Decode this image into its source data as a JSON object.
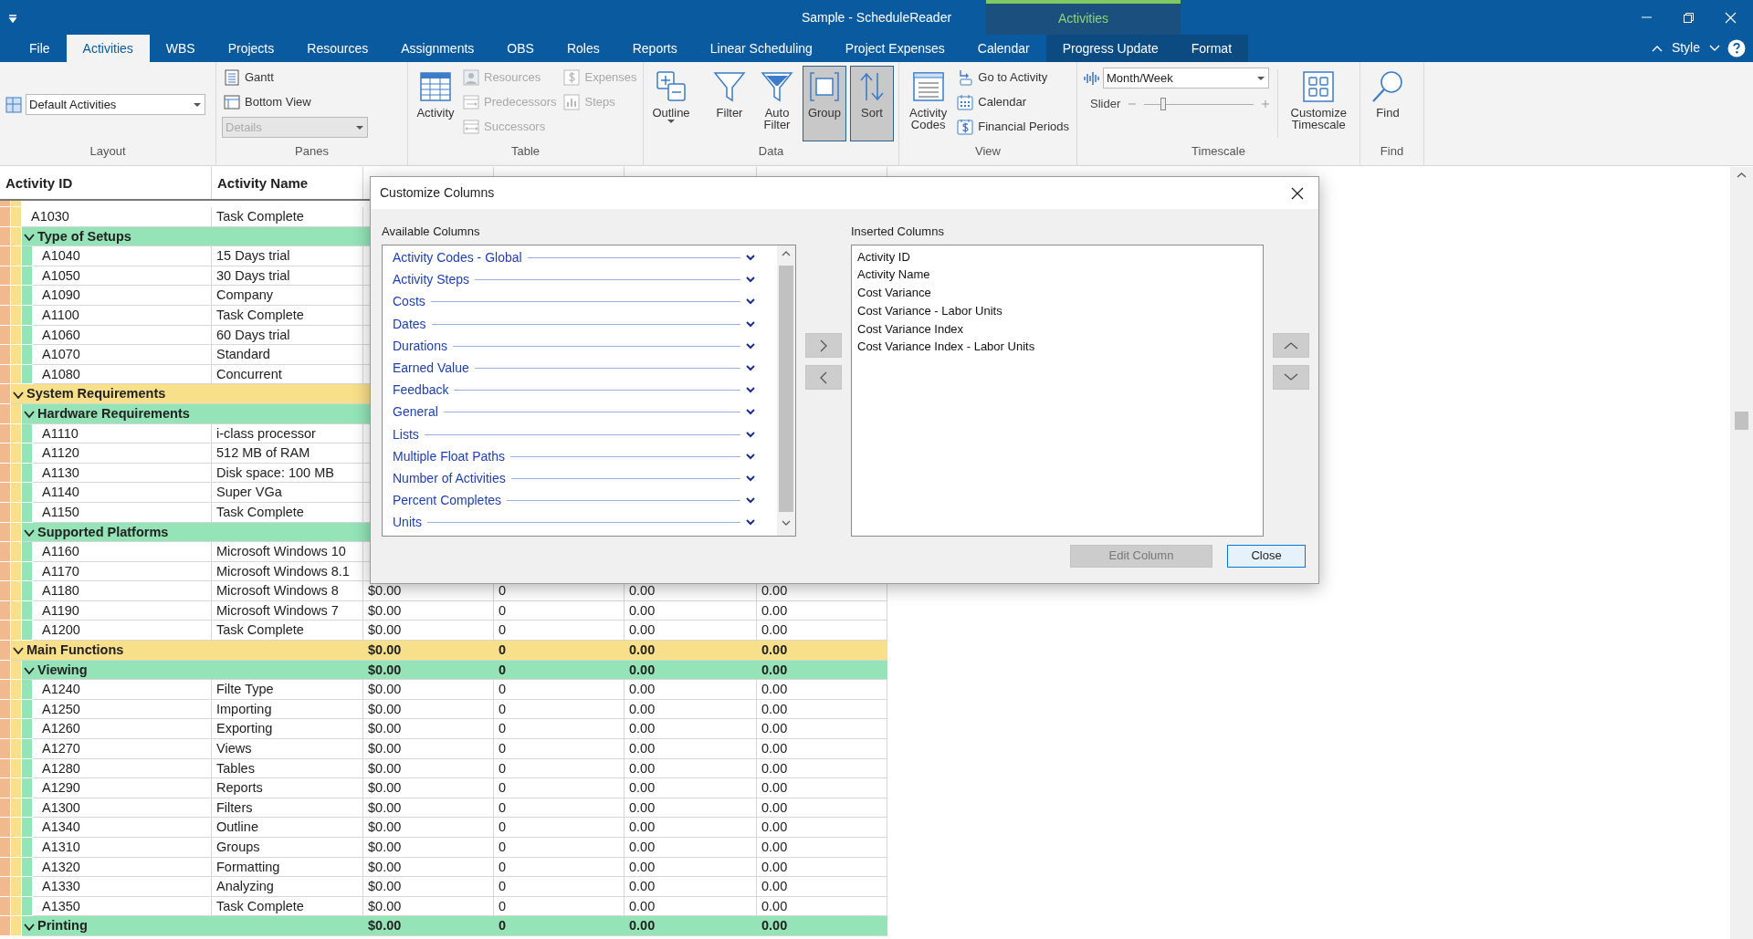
{
  "window": {
    "title": "Sample - ScheduleReader",
    "context_title": "Activities"
  },
  "tabs": [
    {
      "label": "File",
      "selected": false,
      "contextual": false
    },
    {
      "label": "Activities",
      "selected": true,
      "contextual": false
    },
    {
      "label": "WBS",
      "selected": false,
      "contextual": false
    },
    {
      "label": "Projects",
      "selected": false,
      "contextual": false
    },
    {
      "label": "Resources",
      "selected": false,
      "contextual": false
    },
    {
      "label": "Assignments",
      "selected": false,
      "contextual": false
    },
    {
      "label": "OBS",
      "selected": false,
      "contextual": false
    },
    {
      "label": "Roles",
      "selected": false,
      "contextual": false
    },
    {
      "label": "Reports",
      "selected": false,
      "contextual": false
    },
    {
      "label": "Linear Scheduling",
      "selected": false,
      "contextual": false
    },
    {
      "label": "Project Expenses",
      "selected": false,
      "contextual": false
    },
    {
      "label": "Calendar",
      "selected": false,
      "contextual": false
    },
    {
      "label": "Progress Update",
      "selected": false,
      "contextual": true
    },
    {
      "label": "Format",
      "selected": false,
      "contextual": true
    }
  ],
  "style_menu": "Style",
  "ribbon": [
    {
      "label": "Layout",
      "items": [
        {
          "kind": "combo",
          "value": "Default Activities",
          "disabled": false
        }
      ]
    },
    {
      "label": "Panes",
      "items": [
        {
          "kind": "small",
          "label": "Gantt",
          "disabled": false
        },
        {
          "kind": "small",
          "label": "Bottom View",
          "disabled": false
        },
        {
          "kind": "combo",
          "value": "Details",
          "disabled": true
        }
      ]
    },
    {
      "label": "Table",
      "items": [
        {
          "kind": "large",
          "label": "Activity",
          "pressed": false
        },
        {
          "kind": "small",
          "label": "Resources",
          "disabled": true
        },
        {
          "kind": "small",
          "label": "Predecessors",
          "disabled": true
        },
        {
          "kind": "small",
          "label": "Successors",
          "disabled": true
        },
        {
          "kind": "small",
          "label": "Expenses",
          "disabled": true
        },
        {
          "kind": "small",
          "label": "Steps",
          "disabled": true
        }
      ]
    },
    {
      "label": "Data",
      "items": [
        {
          "kind": "large",
          "label": "Outline",
          "pressed": false,
          "menu": true
        },
        {
          "kind": "separator"
        },
        {
          "kind": "large",
          "label": "Filter",
          "pressed": false
        },
        {
          "kind": "large",
          "label": "Auto Filter",
          "pressed": false
        },
        {
          "kind": "large",
          "label": "Group",
          "pressed": true
        },
        {
          "kind": "large",
          "label": "Sort",
          "pressed": true
        }
      ]
    },
    {
      "label": "View",
      "items": [
        {
          "kind": "large",
          "label": "Activity Codes",
          "pressed": false
        },
        {
          "kind": "small",
          "label": "Go to Activity",
          "disabled": false
        },
        {
          "kind": "small",
          "label": "Calendar",
          "disabled": false
        },
        {
          "kind": "small",
          "label": "Financial Periods",
          "disabled": false
        }
      ]
    },
    {
      "label": "Timescale",
      "items": [
        {
          "kind": "combo",
          "value": "Month/Week",
          "disabled": false
        },
        {
          "kind": "slider",
          "label": "Slider",
          "level": 0.17
        },
        {
          "kind": "separator"
        },
        {
          "kind": "large",
          "label": "Customize Timescale",
          "pressed": false
        }
      ]
    },
    {
      "label": "Find",
      "items": [
        {
          "kind": "large",
          "label": "Find",
          "pressed": false
        }
      ]
    }
  ],
  "table": {
    "columns": [
      "Activity ID",
      "Activity Name"
    ],
    "rows": [
      {
        "kind": "group",
        "children": [
          {
            "kind": "activity",
            "id": "A1030",
            "name": "Task Complete"
          },
          {
            "kind": "group",
            "name": "Type of Setups",
            "expanded": true,
            "children": [
              {
                "kind": "activity",
                "id": "A1040",
                "name": "15 Days trial"
              },
              {
                "kind": "activity",
                "id": "A1050",
                "name": "30 Days trial"
              },
              {
                "kind": "activity",
                "id": "A1090",
                "name": "Company"
              },
              {
                "kind": "activity",
                "id": "A1100",
                "name": "Task Complete"
              },
              {
                "kind": "activity",
                "id": "A1060",
                "name": "60 Days trial"
              },
              {
                "kind": "activity",
                "id": "A1070",
                "name": "Standard"
              },
              {
                "kind": "activity",
                "id": "A1080",
                "name": "Concurrent"
              }
            ]
          }
        ]
      },
      {
        "kind": "group",
        "name": "System Requirements",
        "expanded": true,
        "children": [
          {
            "kind": "group",
            "name": "Hardware Requirements",
            "expanded": true,
            "children": [
              {
                "kind": "activity",
                "id": "A1110",
                "name": "i-class processor"
              },
              {
                "kind": "activity",
                "id": "A1120",
                "name": "512 MB of RAM"
              },
              {
                "kind": "activity",
                "id": "A1130",
                "name": "Disk space: 100 MB"
              },
              {
                "kind": "activity",
                "id": "A1140",
                "name": "Super VGa"
              },
              {
                "kind": "activity",
                "id": "A1150",
                "name": "Task Complete"
              }
            ]
          },
          {
            "kind": "group",
            "name": "Supported Platforms",
            "expanded": true,
            "children": [
              {
                "kind": "activity",
                "id": "A1160",
                "name": "Microsoft Windows 10"
              },
              {
                "kind": "activity",
                "id": "A1170",
                "name": "Microsoft Windows 8.1"
              },
              {
                "kind": "activity",
                "id": "A1180",
                "name": "Microsoft Windows 8",
                "values": [
                  "$0.00",
                  "0",
                  "0.00",
                  "0.00"
                ]
              },
              {
                "kind": "activity",
                "id": "A1190",
                "name": "Microsoft Windows 7",
                "values": [
                  "$0.00",
                  "0",
                  "0.00",
                  "0.00"
                ]
              },
              {
                "kind": "activity",
                "id": "A1200",
                "name": "Task Complete",
                "values": [
                  "$0.00",
                  "0",
                  "0.00",
                  "0.00"
                ]
              }
            ]
          }
        ]
      },
      {
        "kind": "group",
        "name": "Main Functions",
        "expanded": true,
        "values": [
          "$0.00",
          "0",
          "0.00",
          "0.00"
        ],
        "children": [
          {
            "kind": "group",
            "name": "Viewing",
            "expanded": true,
            "values": [
              "$0.00",
              "0",
              "0.00",
              "0.00"
            ],
            "children": [
              {
                "kind": "activity",
                "id": "A1240",
                "name": "Filte Type",
                "values": [
                  "$0.00",
                  "0",
                  "0.00",
                  "0.00"
                ]
              },
              {
                "kind": "activity",
                "id": "A1250",
                "name": "Importing",
                "values": [
                  "$0.00",
                  "0",
                  "0.00",
                  "0.00"
                ]
              },
              {
                "kind": "activity",
                "id": "A1260",
                "name": "Exporting",
                "values": [
                  "$0.00",
                  "0",
                  "0.00",
                  "0.00"
                ]
              },
              {
                "kind": "activity",
                "id": "A1270",
                "name": "Views",
                "values": [
                  "$0.00",
                  "0",
                  "0.00",
                  "0.00"
                ]
              },
              {
                "kind": "activity",
                "id": "A1280",
                "name": "Tables",
                "values": [
                  "$0.00",
                  "0",
                  "0.00",
                  "0.00"
                ]
              },
              {
                "kind": "activity",
                "id": "A1290",
                "name": "Reports",
                "values": [
                  "$0.00",
                  "0",
                  "0.00",
                  "0.00"
                ]
              },
              {
                "kind": "activity",
                "id": "A1300",
                "name": "Filters",
                "values": [
                  "$0.00",
                  "0",
                  "0.00",
                  "0.00"
                ]
              },
              {
                "kind": "activity",
                "id": "A1340",
                "name": "Outline",
                "values": [
                  "$0.00",
                  "0",
                  "0.00",
                  "0.00"
                ]
              },
              {
                "kind": "activity",
                "id": "A1310",
                "name": "Groups",
                "values": [
                  "$0.00",
                  "0",
                  "0.00",
                  "0.00"
                ]
              },
              {
                "kind": "activity",
                "id": "A1320",
                "name": "Formatting",
                "values": [
                  "$0.00",
                  "0",
                  "0.00",
                  "0.00"
                ]
              },
              {
                "kind": "activity",
                "id": "A1330",
                "name": "Analyzing",
                "values": [
                  "$0.00",
                  "0",
                  "0.00",
                  "0.00"
                ]
              },
              {
                "kind": "activity",
                "id": "A1350",
                "name": "Task Complete",
                "values": [
                  "$0.00",
                  "0",
                  "0.00",
                  "0.00"
                ]
              }
            ]
          },
          {
            "kind": "group",
            "name": "Printing",
            "expanded": true,
            "values": [
              "$0.00",
              "0",
              "0.00",
              "0.00"
            ]
          }
        ]
      }
    ]
  },
  "dialog": {
    "title": "Customize Columns",
    "available_label": "Available Columns",
    "available": [
      {
        "label": "Activity Codes - Global",
        "expanded": false
      },
      {
        "label": "Activity Steps",
        "expanded": false
      },
      {
        "label": "Costs",
        "expanded": false
      },
      {
        "label": "Dates",
        "expanded": false
      },
      {
        "label": "Durations",
        "expanded": false
      },
      {
        "label": "Earned Value",
        "expanded": false
      },
      {
        "label": "Feedback",
        "expanded": false
      },
      {
        "label": "General",
        "expanded": false
      },
      {
        "label": "Lists",
        "expanded": false
      },
      {
        "label": "Multiple Float Paths",
        "expanded": false
      },
      {
        "label": "Number of Activities",
        "expanded": false
      },
      {
        "label": "Percent Completes",
        "expanded": false
      },
      {
        "label": "Units",
        "expanded": false
      }
    ],
    "inserted_label": "Inserted Columns",
    "inserted": [
      "Activity ID",
      "Activity Name",
      "Cost Variance",
      "Cost Variance - Labor Units",
      "Cost Variance Index",
      "Cost Variance Index - Labor Units"
    ],
    "buttons": [
      {
        "label": "Edit Column",
        "disabled": true,
        "default": false
      },
      {
        "label": "Close",
        "disabled": false,
        "default": true
      }
    ]
  }
}
